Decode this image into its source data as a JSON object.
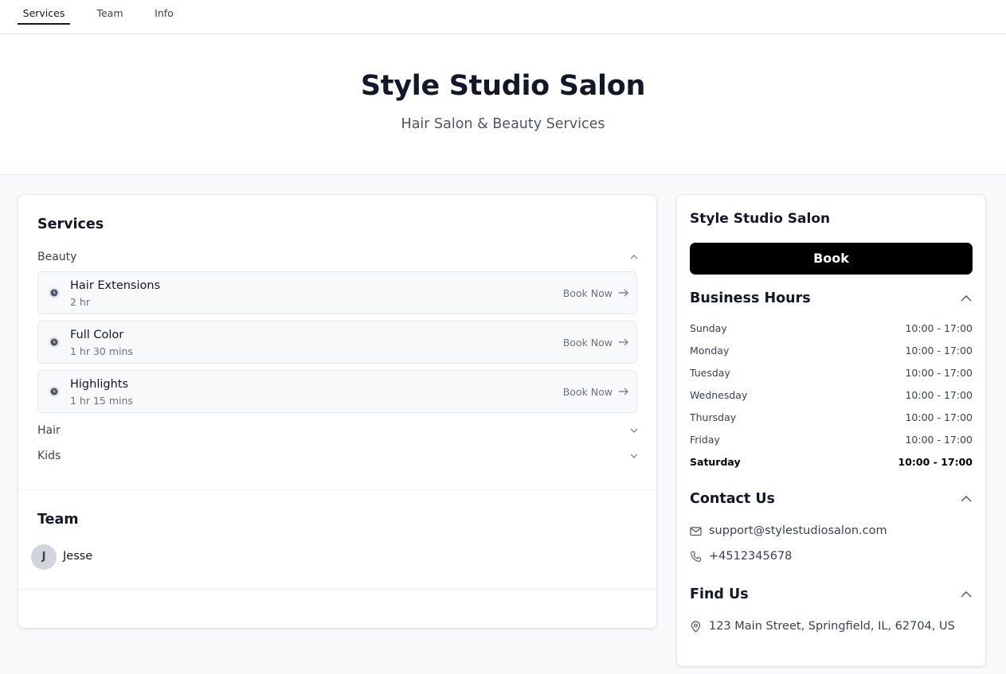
{
  "nav": {
    "tabs": [
      {
        "label": "Services"
      },
      {
        "label": "Team"
      },
      {
        "label": "Info"
      }
    ]
  },
  "hero": {
    "title": "Style Studio Salon",
    "subtitle": "Hair Salon & Beauty Services"
  },
  "services": {
    "heading": "Services",
    "categories": [
      {
        "label": "Beauty",
        "expanded": true
      },
      {
        "label": "Hair",
        "expanded": false
      },
      {
        "label": "Kids",
        "expanded": false
      }
    ],
    "items": [
      {
        "name": "Hair Extensions",
        "duration": "2 hr",
        "action": "Book Now"
      },
      {
        "name": "Full Color",
        "duration": "1 hr 30 mins",
        "action": "Book Now"
      },
      {
        "name": "Highlights",
        "duration": "1 hr 15 mins",
        "action": "Book Now"
      }
    ]
  },
  "team": {
    "heading": "Team",
    "members": [
      {
        "initial": "J",
        "name": "Jesse"
      }
    ]
  },
  "sidebar": {
    "title": "Style Studio Salon",
    "book_label": "Book",
    "hours": {
      "heading": "Business Hours",
      "days": [
        {
          "day": "Sunday",
          "time": "10:00 - 17:00"
        },
        {
          "day": "Monday",
          "time": "10:00 - 17:00"
        },
        {
          "day": "Tuesday",
          "time": "10:00 - 17:00"
        },
        {
          "day": "Wednesday",
          "time": "10:00 - 17:00"
        },
        {
          "day": "Thursday",
          "time": "10:00 - 17:00"
        },
        {
          "day": "Friday",
          "time": "10:00 - 17:00"
        },
        {
          "day": "Saturday",
          "time": "10:00 - 17:00"
        }
      ]
    },
    "contact": {
      "heading": "Contact Us",
      "email": "support@stylestudiosalon.com",
      "phone": "+4512345678"
    },
    "location": {
      "heading": "Find Us",
      "address": "123 Main Street, Springfield, IL, 62704, US"
    }
  },
  "colors": {
    "accent": "#000000",
    "text": "#111827",
    "muted": "#6b7280",
    "background": "#f8f9fb"
  }
}
